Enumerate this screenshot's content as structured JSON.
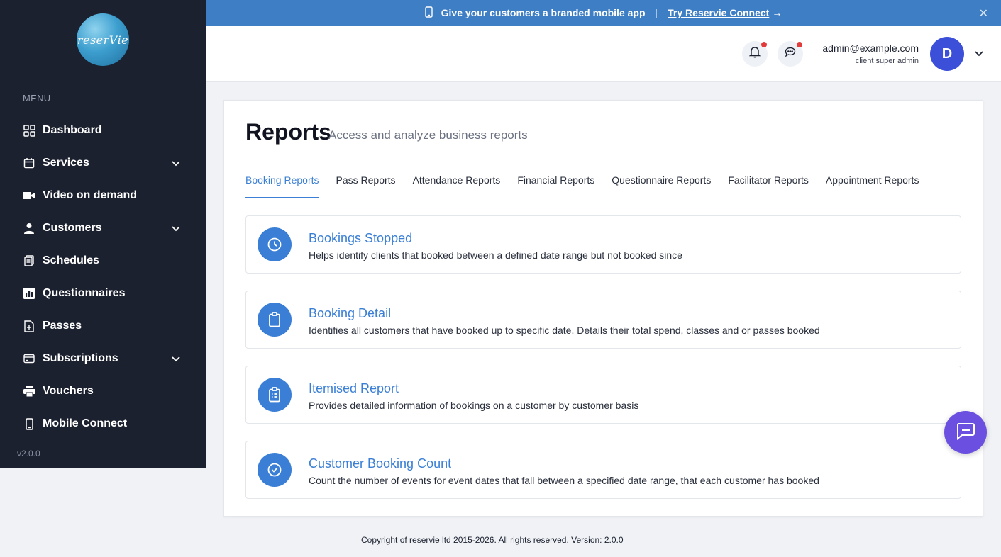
{
  "brand": {
    "logo_text": "reserVie"
  },
  "sidebar": {
    "menu_label": "MENU",
    "items": [
      {
        "label": "Dashboard",
        "icon": "dashboard-grid-icon",
        "has_submenu": false
      },
      {
        "label": "Services",
        "icon": "calendar-icon",
        "has_submenu": true
      },
      {
        "label": "Video on demand",
        "icon": "video-camera-icon",
        "has_submenu": false
      },
      {
        "label": "Customers",
        "icon": "user-icon",
        "has_submenu": true
      },
      {
        "label": "Schedules",
        "icon": "schedule-stack-icon",
        "has_submenu": false
      },
      {
        "label": "Questionnaires",
        "icon": "bar-chart-icon",
        "has_submenu": false
      },
      {
        "label": "Passes",
        "icon": "pass-document-icon",
        "has_submenu": false
      },
      {
        "label": "Subscriptions",
        "icon": "credit-card-icon",
        "has_submenu": true
      },
      {
        "label": "Vouchers",
        "icon": "printer-icon",
        "has_submenu": false
      },
      {
        "label": "Mobile Connect",
        "icon": "mobile-phone-icon",
        "has_submenu": false
      }
    ],
    "version": "v2.0.0"
  },
  "banner": {
    "message": "Give your customers a branded mobile app",
    "separator": "|",
    "cta": "Try Reservie Connect",
    "cta_arrow": "→",
    "close": "✕"
  },
  "header": {
    "user_email": "admin@example.com",
    "user_role": "client super admin",
    "avatar_initial": "D"
  },
  "page": {
    "title": "Reports",
    "subtitle": "Access and analyze business reports",
    "tabs": [
      {
        "label": "Booking Reports",
        "active": true
      },
      {
        "label": "Pass Reports",
        "active": false
      },
      {
        "label": "Attendance Reports",
        "active": false
      },
      {
        "label": "Financial Reports",
        "active": false
      },
      {
        "label": "Questionnaire Reports",
        "active": false
      },
      {
        "label": "Facilitator Reports",
        "active": false
      },
      {
        "label": "Appointment Reports",
        "active": false
      }
    ],
    "reports": [
      {
        "title": "Bookings Stopped",
        "description": "Helps identify clients that booked between a defined date range but not booked since",
        "icon": "clock-icon"
      },
      {
        "title": "Booking Detail",
        "description": "Identifies all customers that have booked up to specific date. Details their total spend, classes and or passes booked",
        "icon": "clipboard-icon"
      },
      {
        "title": "Itemised Report",
        "description": "Provides detailed information of bookings on a customer by customer basis",
        "icon": "clipboard-list-icon"
      },
      {
        "title": "Customer Booking Count",
        "description": "Count the number of events for event dates that fall between a specified date range, that each customer has booked",
        "icon": "check-circle-icon"
      }
    ]
  },
  "footer": {
    "text": "Copyright of reservie ltd 2015-2026. All rights reserved. Version: 2.0.0"
  },
  "colors": {
    "sidebar_bg": "#1c2130",
    "banner_bg": "#3e7ec4",
    "accent": "#3a7fd5",
    "avatar_bg": "#3b4fd8",
    "chat_fab": "#6a4fe0",
    "notification_dot": "#e23b3b"
  }
}
